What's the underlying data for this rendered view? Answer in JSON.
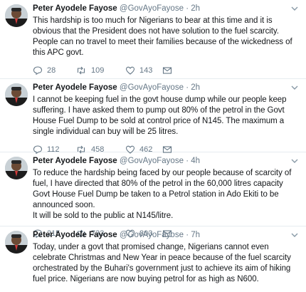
{
  "user": {
    "name": "Peter Ayodele Fayose",
    "handle": "@GovAyoFayose",
    "separator": "·"
  },
  "tweets": [
    {
      "time": "2h",
      "paragraphs": [
        "This hardship is too much for Nigerians to bear at this time and it is obvious that the President does not have solution to the fuel scarcity.",
        "People can no travel to meet their families because of the wickedness of this APC govt."
      ],
      "replies": "28",
      "retweets": "109",
      "likes": "143"
    },
    {
      "time": "2h",
      "paragraphs": [
        "I cannot be keeping fuel in the govt house dump while our people keep suffering. I have asked them to pump out 80% of the petrol in the Govt House Fuel Dump to be sold at control price of N145.  The maximum a single individual can buy will be 25 litres."
      ],
      "replies": "112",
      "retweets": "458",
      "likes": "462"
    },
    {
      "time": "4h",
      "paragraphs": [
        "To reduce the hardship being faced by our people because of scarcity of fuel, I have directed that 80% of the petrol in the 60,000 litres capacity Govt House Fuel Dump be taken to a Petrol station in Ado Ekiti to be announced soon.",
        "It will be sold to the public at N145/litre."
      ],
      "replies": "215",
      "retweets": "733",
      "likes": "803"
    },
    {
      "time": "7h",
      "paragraphs": [
        "Today, under a govt that promised change, Nigerians cannot even celebrate Christmas and New Year in peace because of the fuel scarcity orchestrated by the Buhari's government just to achieve its aim of hiking fuel price. Nigerians are now buying petrol for as high as N600."
      ],
      "replies": "",
      "retweets": "",
      "likes": ""
    }
  ],
  "icons": {
    "reply": "reply-icon",
    "retweet": "retweet-icon",
    "like": "heart-icon",
    "mail": "direct-message-icon",
    "menu": "chevron-down-icon"
  },
  "colors": {
    "text": "#14171a",
    "secondary": "#657786",
    "divider": "#e6ecf0"
  }
}
